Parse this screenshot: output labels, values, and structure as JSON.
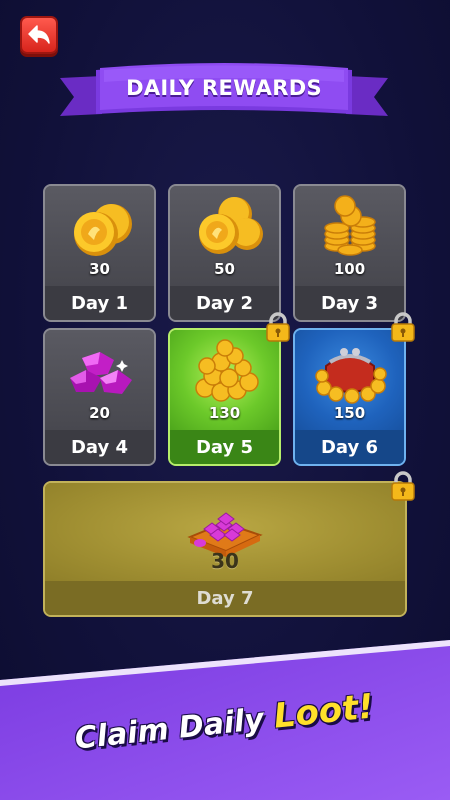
{
  "title": "DAILY REWARDS",
  "rewards": [
    {
      "day": "Day 1",
      "amount": "30",
      "icon": "coins-small-icon",
      "locked": false
    },
    {
      "day": "Day 2",
      "amount": "50",
      "icon": "coins-medium-icon",
      "locked": false
    },
    {
      "day": "Day 3",
      "amount": "100",
      "icon": "coin-stacks-icon",
      "locked": false
    },
    {
      "day": "Day 4",
      "amount": "20",
      "icon": "gems-icon",
      "locked": false
    },
    {
      "day": "Day 5",
      "amount": "130",
      "icon": "coin-pile-icon",
      "locked": true,
      "highlight": "current"
    },
    {
      "day": "Day 6",
      "amount": "150",
      "icon": "coin-purse-icon",
      "locked": true
    },
    {
      "day": "Day 7",
      "amount": "30",
      "icon": "gem-crate-icon",
      "locked": true
    }
  ],
  "slogan": {
    "part1": "Claim Daily ",
    "part2": "Loot!"
  },
  "colors": {
    "accent": "#8a3fe0",
    "current_day": "#6cc92a",
    "next_day": "#1f63bd",
    "grand_prize": "#a08f32",
    "coin": "#f4b81a",
    "gem": "#d83ad8"
  }
}
